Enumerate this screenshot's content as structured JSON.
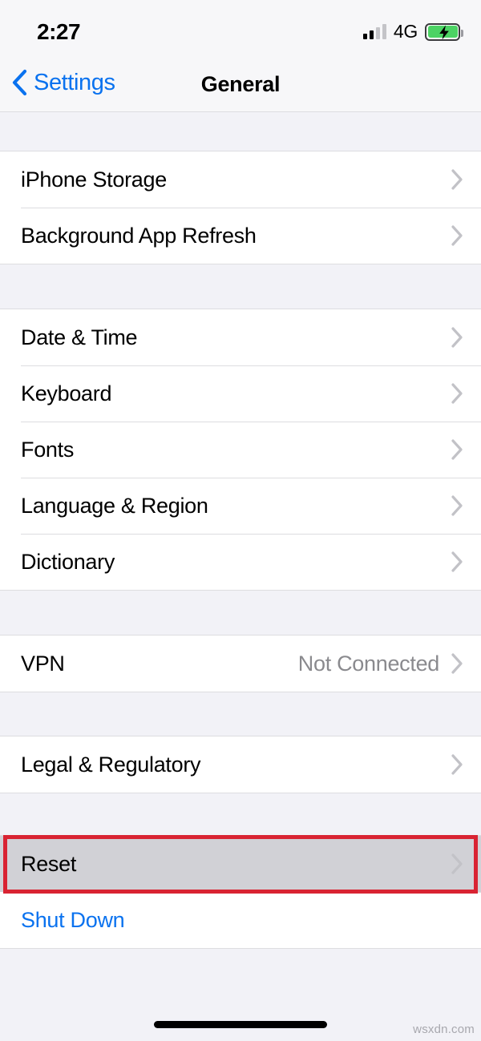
{
  "status_bar": {
    "time": "2:27",
    "network_label": "4G",
    "signal_bars_total": 4,
    "signal_bars_filled": 2,
    "battery_charging": true,
    "battery_color": "#4CD364"
  },
  "nav": {
    "back_label": "Settings",
    "title": "General",
    "accent_color": "#0A72EF"
  },
  "sections": [
    {
      "name": "storage-section",
      "rows": [
        {
          "label": "iPhone Storage",
          "value": "",
          "accessory": "chevron",
          "style": "default"
        },
        {
          "label": "Background App Refresh",
          "value": "",
          "accessory": "chevron",
          "style": "default"
        }
      ]
    },
    {
      "name": "localization-section",
      "rows": [
        {
          "label": "Date & Time",
          "value": "",
          "accessory": "chevron",
          "style": "default"
        },
        {
          "label": "Keyboard",
          "value": "",
          "accessory": "chevron",
          "style": "default"
        },
        {
          "label": "Fonts",
          "value": "",
          "accessory": "chevron",
          "style": "default"
        },
        {
          "label": "Language & Region",
          "value": "",
          "accessory": "chevron",
          "style": "default"
        },
        {
          "label": "Dictionary",
          "value": "",
          "accessory": "chevron",
          "style": "default"
        }
      ]
    },
    {
      "name": "vpn-section",
      "rows": [
        {
          "label": "VPN",
          "value": "Not Connected",
          "accessory": "chevron",
          "style": "default"
        }
      ]
    },
    {
      "name": "legal-section",
      "rows": [
        {
          "label": "Legal & Regulatory",
          "value": "",
          "accessory": "chevron",
          "style": "default"
        }
      ]
    },
    {
      "name": "reset-section",
      "rows": [
        {
          "label": "Reset",
          "value": "",
          "accessory": "chevron",
          "style": "pressed"
        },
        {
          "label": "Shut Down",
          "value": "",
          "accessory": "none",
          "style": "link"
        }
      ]
    }
  ],
  "annotation": {
    "target_row": "Reset",
    "color": "#D92332"
  },
  "watermark": {
    "text": "wsxdn.com"
  }
}
